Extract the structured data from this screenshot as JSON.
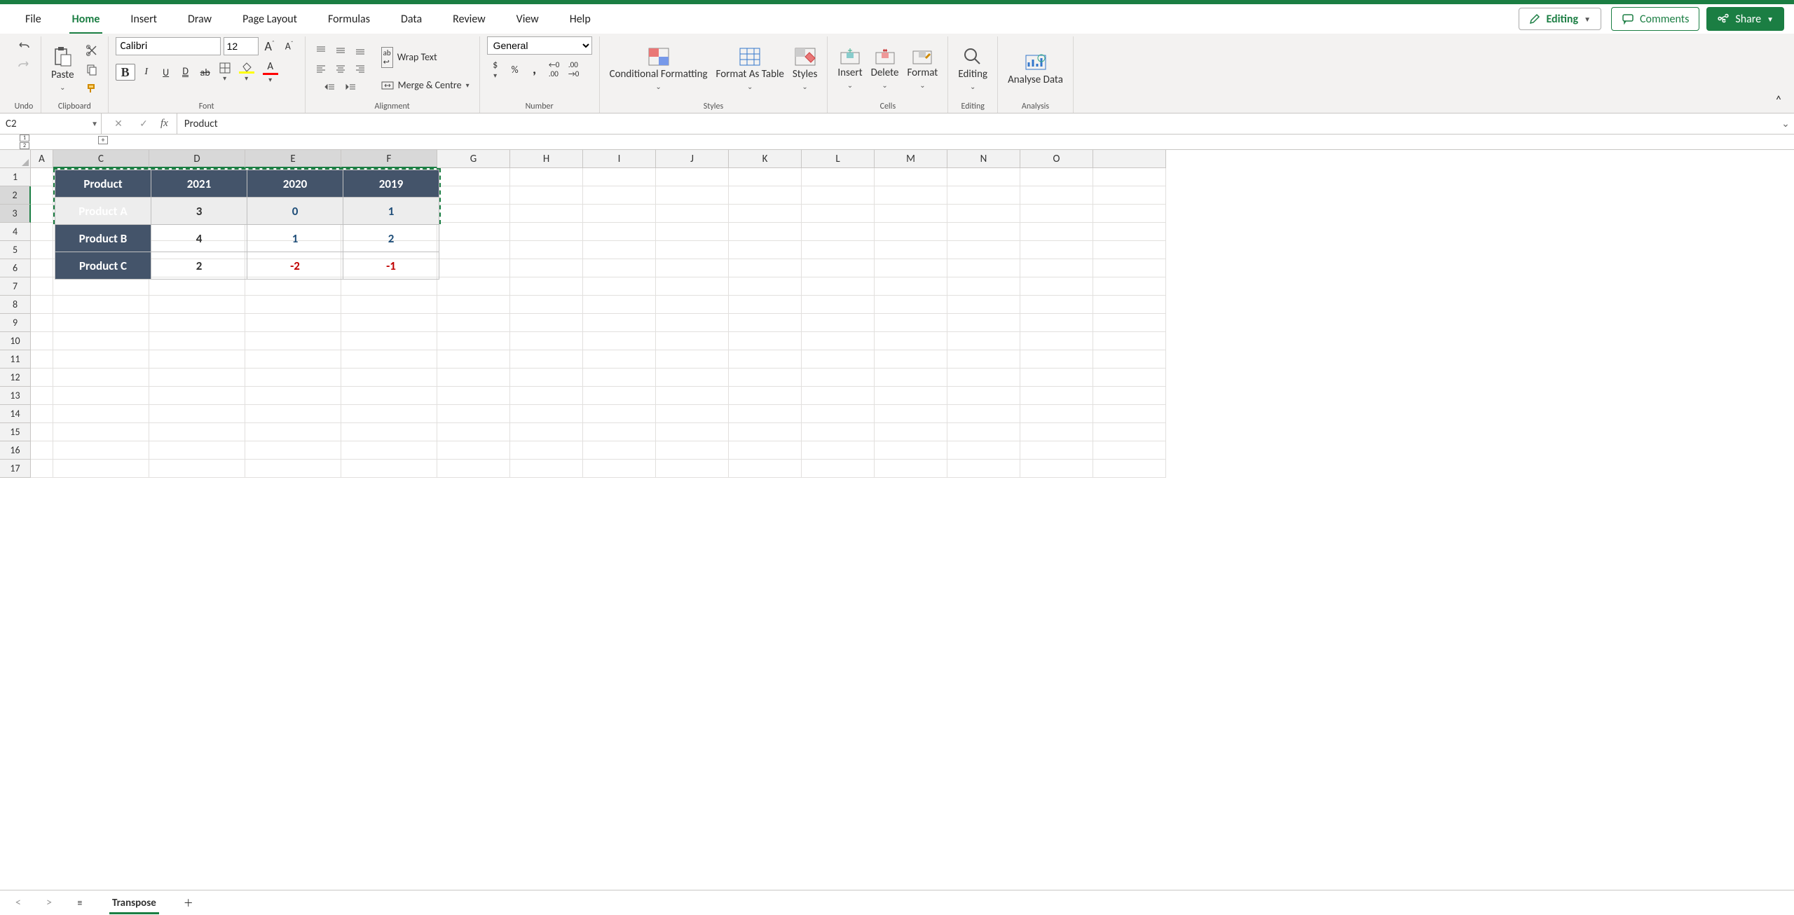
{
  "menu": {
    "tabs": [
      "File",
      "Home",
      "Insert",
      "Draw",
      "Page Layout",
      "Formulas",
      "Data",
      "Review",
      "View",
      "Help"
    ],
    "active": 1
  },
  "mode": {
    "label": "Editing"
  },
  "actions": {
    "comments": "Comments",
    "share": "Share"
  },
  "ribbon": {
    "undo": {
      "label": "Undo"
    },
    "clipboard": {
      "label": "Clipboard",
      "paste": "Paste"
    },
    "font": {
      "label": "Font",
      "name": "Calibri",
      "size": "12"
    },
    "alignment": {
      "label": "Alignment",
      "wrap": "Wrap Text",
      "merge": "Merge & Centre"
    },
    "number": {
      "label": "Number",
      "format": "General"
    },
    "styles": {
      "label": "Styles",
      "cond": "Conditional Formatting",
      "fat": "Format As Table",
      "sty": "Styles"
    },
    "cells": {
      "label": "Cells",
      "ins": "Insert",
      "del": "Delete",
      "fmt": "Format"
    },
    "editing": {
      "label": "Editing",
      "edit": "Editing"
    },
    "analysis": {
      "label": "Analysis",
      "analyse": "Analyse Data"
    }
  },
  "formulaBar": {
    "nameBox": "C2",
    "value": "Product"
  },
  "columns": [
    "A",
    "C",
    "D",
    "E",
    "F",
    "G",
    "H",
    "I",
    "J",
    "K",
    "L",
    "M",
    "N",
    "O"
  ],
  "rows": [
    "1",
    "2",
    "3",
    "4",
    "5",
    "6",
    "7",
    "8",
    "9",
    "10",
    "11",
    "12",
    "13",
    "14",
    "15",
    "16",
    "17"
  ],
  "table": {
    "headers": [
      "Product",
      "2021",
      "2020",
      "2019"
    ],
    "rows": [
      {
        "label": "Product A",
        "v": [
          3,
          0,
          1
        ],
        "cls": [
          "",
          "val-pos",
          "val-pos"
        ]
      },
      {
        "label": "Product B",
        "v": [
          4,
          1,
          2
        ],
        "cls": [
          "",
          "val-pos",
          "val-pos"
        ]
      },
      {
        "label": "Product C",
        "v": [
          2,
          -2,
          -1
        ],
        "cls": [
          "",
          "val-neg",
          "val-neg"
        ]
      }
    ]
  },
  "sheetTabs": {
    "active": "Transpose"
  }
}
